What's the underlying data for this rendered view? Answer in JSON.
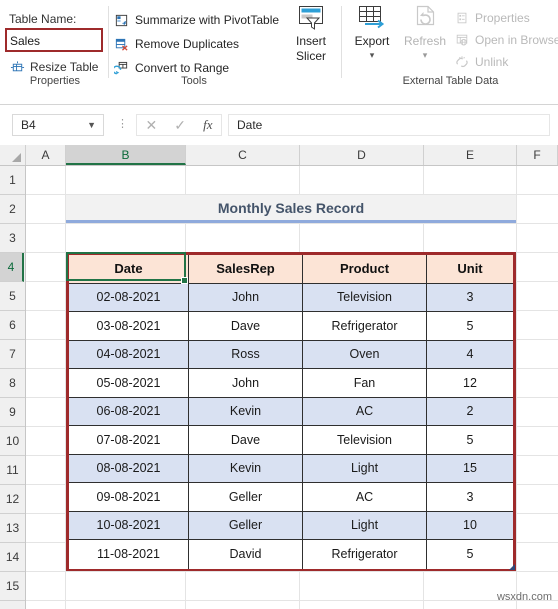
{
  "ribbon": {
    "groups": [
      {
        "name": "Properties",
        "label": "Properties"
      },
      {
        "name": "Tools",
        "label": "Tools"
      },
      {
        "name": "ExternalTableData",
        "label": "External Table Data"
      }
    ],
    "properties": {
      "table_name_label": "Table Name:",
      "table_name_value": "Sales",
      "resize_table": "Resize Table"
    },
    "tools": {
      "summarize": "Summarize with PivotTable",
      "remove_duplicates": "Remove Duplicates",
      "convert_to_range": "Convert to Range",
      "insert_slicer_line1": "Insert",
      "insert_slicer_line2": "Slicer"
    },
    "external": {
      "export": "Export",
      "refresh": "Refresh",
      "properties": "Properties",
      "open_in_browser": "Open in Browser",
      "unlink": "Unlink"
    }
  },
  "formula_bar": {
    "name_box": "B4",
    "formula_value": "Date",
    "cancel_icon": "✕",
    "enter_icon": "✓",
    "function_icon": "fx"
  },
  "grid": {
    "columns": [
      "A",
      "B",
      "C",
      "D",
      "E",
      "F"
    ],
    "selected_column": "B",
    "rows": [
      "1",
      "2",
      "3",
      "4",
      "5",
      "6",
      "7",
      "8",
      "9",
      "10",
      "11",
      "12",
      "13",
      "14",
      "15"
    ],
    "selected_row": "4"
  },
  "sheet": {
    "title": "Monthly Sales Record",
    "table": {
      "headers": [
        "Date",
        "SalesRep",
        "Product",
        "Unit"
      ],
      "rows": [
        [
          "02-08-2021",
          "John",
          "Television",
          "3"
        ],
        [
          "03-08-2021",
          "Dave",
          "Refrigerator",
          "5"
        ],
        [
          "04-08-2021",
          "Ross",
          "Oven",
          "4"
        ],
        [
          "05-08-2021",
          "John",
          "Fan",
          "12"
        ],
        [
          "06-08-2021",
          "Kevin",
          "AC",
          "2"
        ],
        [
          "07-08-2021",
          "Dave",
          "Television",
          "5"
        ],
        [
          "08-08-2021",
          "Kevin",
          "Light",
          "15"
        ],
        [
          "09-08-2021",
          "Geller",
          "AC",
          "3"
        ],
        [
          "10-08-2021",
          "Geller",
          "Light",
          "10"
        ],
        [
          "11-08-2021",
          "David",
          "Refrigerator",
          "5"
        ]
      ]
    }
  },
  "watermark": "wsxdn.com",
  "colors": {
    "table_border": "#9e2a2b",
    "header_fill": "#fce4d6",
    "band_fill": "#d9e1f2",
    "selection_green": "#217346",
    "title_accent": "#8faadc",
    "title_text": "#44546a"
  }
}
